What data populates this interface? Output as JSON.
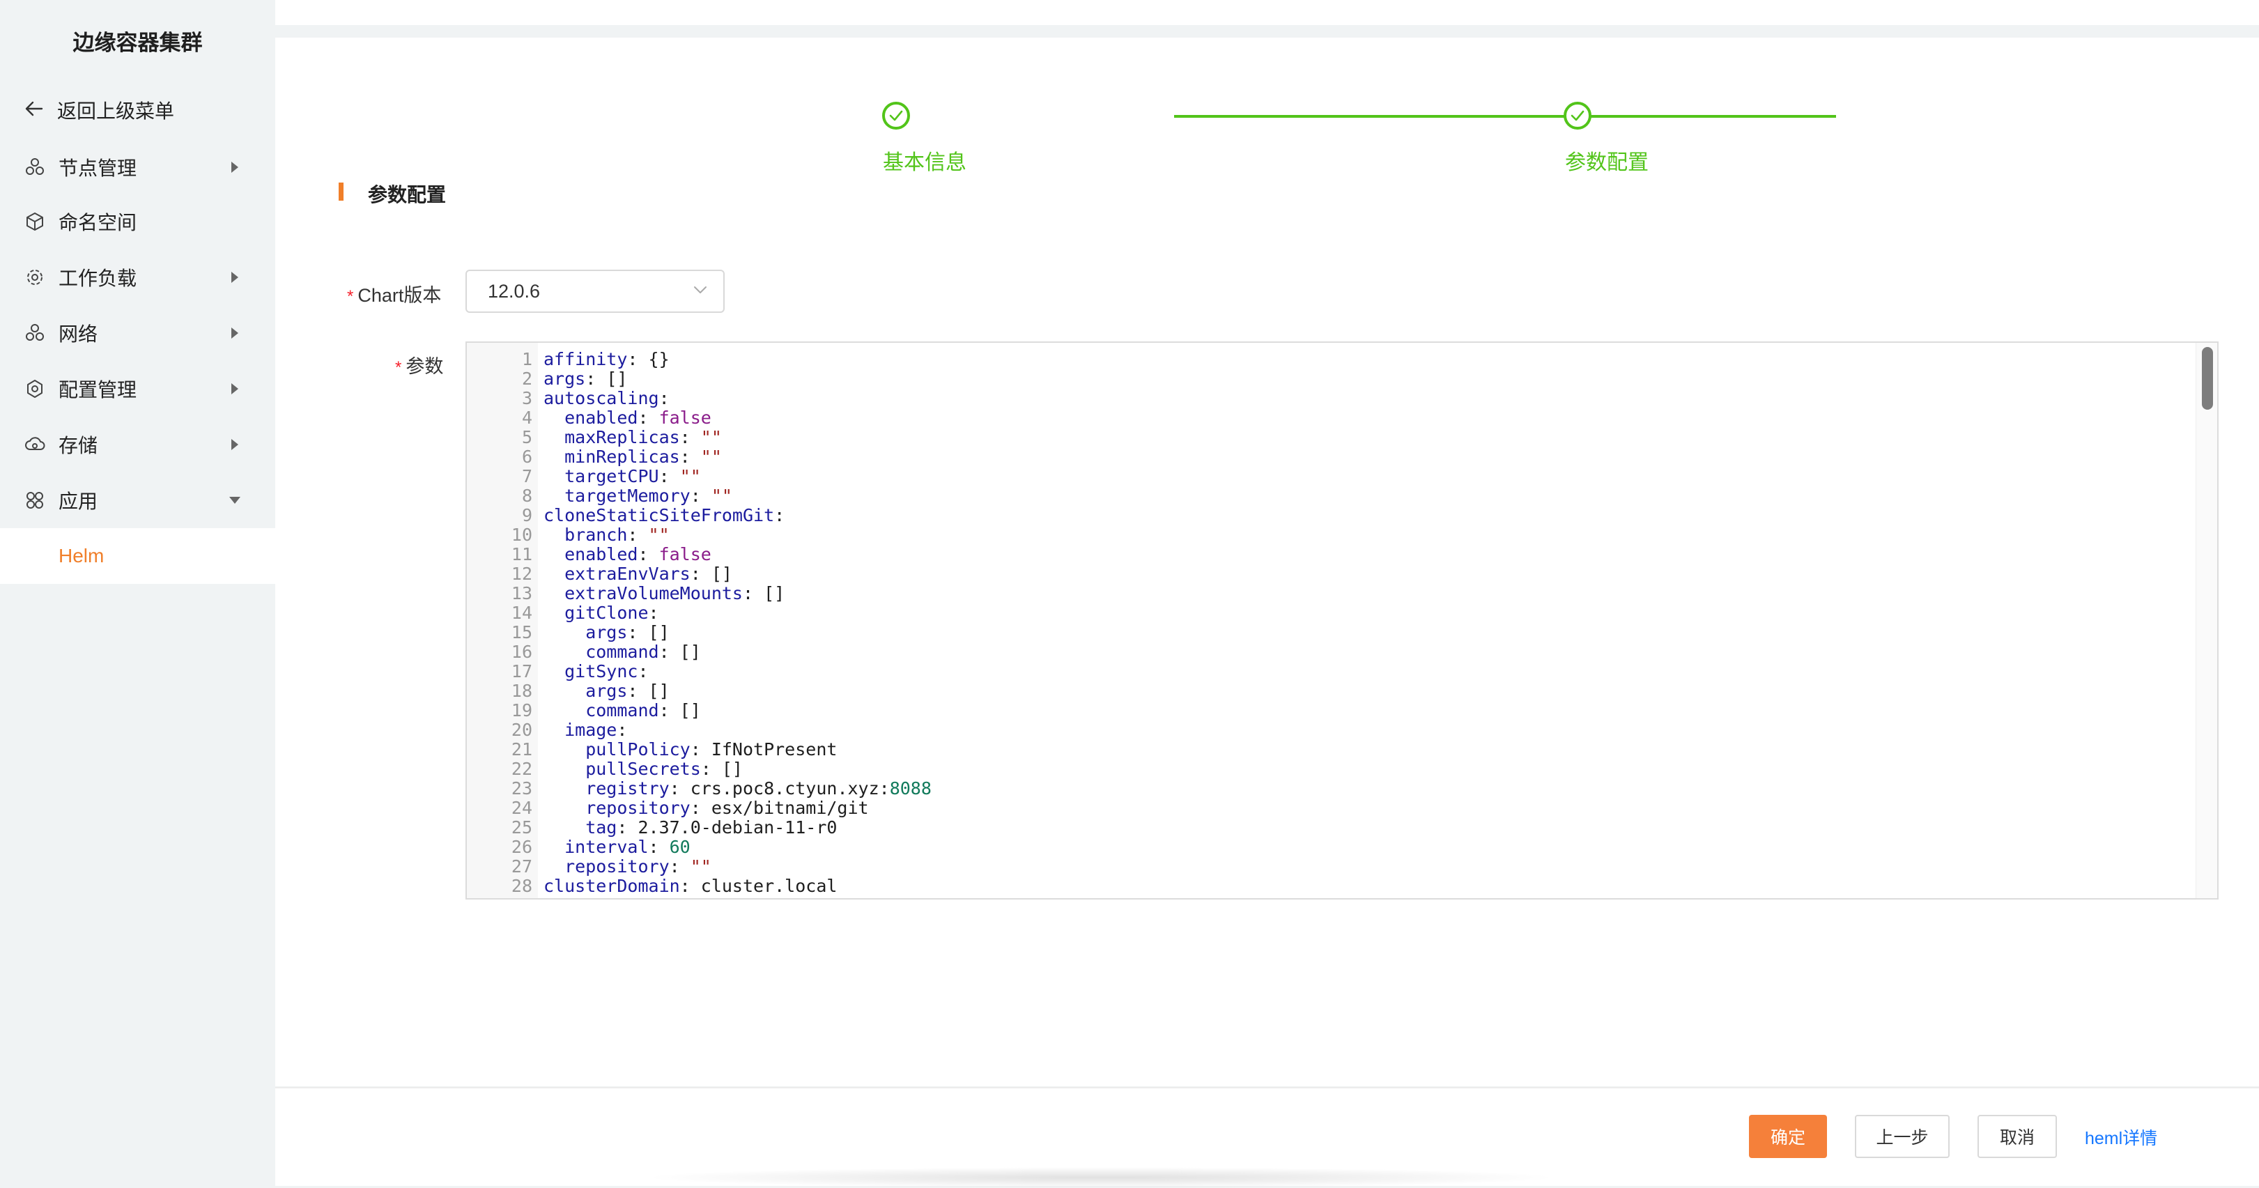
{
  "sidebar": {
    "title": "边缘容器集群",
    "back_label": "返回上级菜单",
    "items": [
      {
        "label": "节点管理",
        "icon": "cluster-icon",
        "has_children": true,
        "expanded": false
      },
      {
        "label": "命名空间",
        "icon": "cube-icon",
        "has_children": false,
        "expanded": false
      },
      {
        "label": "工作负载",
        "icon": "gear-cluster-icon",
        "has_children": true,
        "expanded": false
      },
      {
        "label": "网络",
        "icon": "network-icon",
        "has_children": true,
        "expanded": false
      },
      {
        "label": "配置管理",
        "icon": "settings-icon",
        "has_children": true,
        "expanded": false
      },
      {
        "label": "存储",
        "icon": "cloud-storage-icon",
        "has_children": true,
        "expanded": false
      },
      {
        "label": "应用",
        "icon": "apps-icon",
        "has_children": true,
        "expanded": true
      }
    ],
    "active_sub_item": "Helm"
  },
  "steps": [
    {
      "label": "基本信息",
      "status": "done"
    },
    {
      "label": "参数配置",
      "status": "done"
    }
  ],
  "section": {
    "title": "参数配置"
  },
  "form": {
    "chart_version_label": "Chart版本",
    "chart_version_value": "12.0.6",
    "params_label": "参数",
    "required_mark": "*"
  },
  "editor": {
    "lines": [
      {
        "n": "1",
        "t": [
          {
            "c": "k",
            "v": "affinity"
          },
          {
            "c": "plain",
            "v": ": {}"
          }
        ]
      },
      {
        "n": "2",
        "t": [
          {
            "c": "k",
            "v": "args"
          },
          {
            "c": "plain",
            "v": ": []"
          }
        ]
      },
      {
        "n": "3",
        "t": [
          {
            "c": "k",
            "v": "autoscaling"
          },
          {
            "c": "plain",
            "v": ":"
          }
        ]
      },
      {
        "n": "4",
        "t": [
          {
            "c": "k",
            "v": "  enabled"
          },
          {
            "c": "plain",
            "v": ": "
          },
          {
            "c": "bool",
            "v": "false"
          }
        ]
      },
      {
        "n": "5",
        "t": [
          {
            "c": "k",
            "v": "  maxReplicas"
          },
          {
            "c": "plain",
            "v": ": "
          },
          {
            "c": "str",
            "v": "\"\""
          }
        ]
      },
      {
        "n": "6",
        "t": [
          {
            "c": "k",
            "v": "  minReplicas"
          },
          {
            "c": "plain",
            "v": ": "
          },
          {
            "c": "str",
            "v": "\"\""
          }
        ]
      },
      {
        "n": "7",
        "t": [
          {
            "c": "k",
            "v": "  targetCPU"
          },
          {
            "c": "plain",
            "v": ": "
          },
          {
            "c": "str",
            "v": "\"\""
          }
        ]
      },
      {
        "n": "8",
        "t": [
          {
            "c": "k",
            "v": "  targetMemory"
          },
          {
            "c": "plain",
            "v": ": "
          },
          {
            "c": "str",
            "v": "\"\""
          }
        ]
      },
      {
        "n": "9",
        "t": [
          {
            "c": "k",
            "v": "cloneStaticSiteFromGit"
          },
          {
            "c": "plain",
            "v": ":"
          }
        ]
      },
      {
        "n": "10",
        "t": [
          {
            "c": "k",
            "v": "  branch"
          },
          {
            "c": "plain",
            "v": ": "
          },
          {
            "c": "str",
            "v": "\"\""
          }
        ]
      },
      {
        "n": "11",
        "t": [
          {
            "c": "k",
            "v": "  enabled"
          },
          {
            "c": "plain",
            "v": ": "
          },
          {
            "c": "bool",
            "v": "false"
          }
        ]
      },
      {
        "n": "12",
        "t": [
          {
            "c": "k",
            "v": "  extraEnvVars"
          },
          {
            "c": "plain",
            "v": ": []"
          }
        ]
      },
      {
        "n": "13",
        "t": [
          {
            "c": "k",
            "v": "  extraVolumeMounts"
          },
          {
            "c": "plain",
            "v": ": []"
          }
        ]
      },
      {
        "n": "14",
        "t": [
          {
            "c": "k",
            "v": "  gitClone"
          },
          {
            "c": "plain",
            "v": ":"
          }
        ]
      },
      {
        "n": "15",
        "t": [
          {
            "c": "k",
            "v": "    args"
          },
          {
            "c": "plain",
            "v": ": []"
          }
        ]
      },
      {
        "n": "16",
        "t": [
          {
            "c": "k",
            "v": "    command"
          },
          {
            "c": "plain",
            "v": ": []"
          }
        ]
      },
      {
        "n": "17",
        "t": [
          {
            "c": "k",
            "v": "  gitSync"
          },
          {
            "c": "plain",
            "v": ":"
          }
        ]
      },
      {
        "n": "18",
        "t": [
          {
            "c": "k",
            "v": "    args"
          },
          {
            "c": "plain",
            "v": ": []"
          }
        ]
      },
      {
        "n": "19",
        "t": [
          {
            "c": "k",
            "v": "    command"
          },
          {
            "c": "plain",
            "v": ": []"
          }
        ]
      },
      {
        "n": "20",
        "t": [
          {
            "c": "k",
            "v": "  image"
          },
          {
            "c": "plain",
            "v": ":"
          }
        ]
      },
      {
        "n": "21",
        "t": [
          {
            "c": "k",
            "v": "    pullPolicy"
          },
          {
            "c": "plain",
            "v": ": IfNotPresent"
          }
        ]
      },
      {
        "n": "22",
        "t": [
          {
            "c": "k",
            "v": "    pullSecrets"
          },
          {
            "c": "plain",
            "v": ": []"
          }
        ]
      },
      {
        "n": "23",
        "t": [
          {
            "c": "k",
            "v": "    registry"
          },
          {
            "c": "plain",
            "v": ": crs.poc8.ctyun.xyz:"
          },
          {
            "c": "num",
            "v": "8088"
          }
        ]
      },
      {
        "n": "24",
        "t": [
          {
            "c": "k",
            "v": "    repository"
          },
          {
            "c": "plain",
            "v": ": esx/bitnami/git"
          }
        ]
      },
      {
        "n": "25",
        "t": [
          {
            "c": "k",
            "v": "    tag"
          },
          {
            "c": "plain",
            "v": ": 2.37.0-debian-11-r0"
          }
        ]
      },
      {
        "n": "26",
        "t": [
          {
            "c": "k",
            "v": "  interval"
          },
          {
            "c": "plain",
            "v": ": "
          },
          {
            "c": "num",
            "v": "60"
          }
        ]
      },
      {
        "n": "27",
        "t": [
          {
            "c": "k",
            "v": "  repository"
          },
          {
            "c": "plain",
            "v": ": "
          },
          {
            "c": "str",
            "v": "\"\""
          }
        ]
      },
      {
        "n": "28",
        "t": [
          {
            "c": "k",
            "v": "clusterDomain"
          },
          {
            "c": "plain",
            "v": ": cluster.local"
          }
        ]
      }
    ]
  },
  "footer": {
    "confirm_label": "确定",
    "prev_label": "上一步",
    "cancel_label": "取消",
    "details_link": "heml详情"
  },
  "colors": {
    "accent": "#f5803a",
    "success": "#52c41a",
    "link": "#1677ff",
    "required": "#f5222d"
  }
}
